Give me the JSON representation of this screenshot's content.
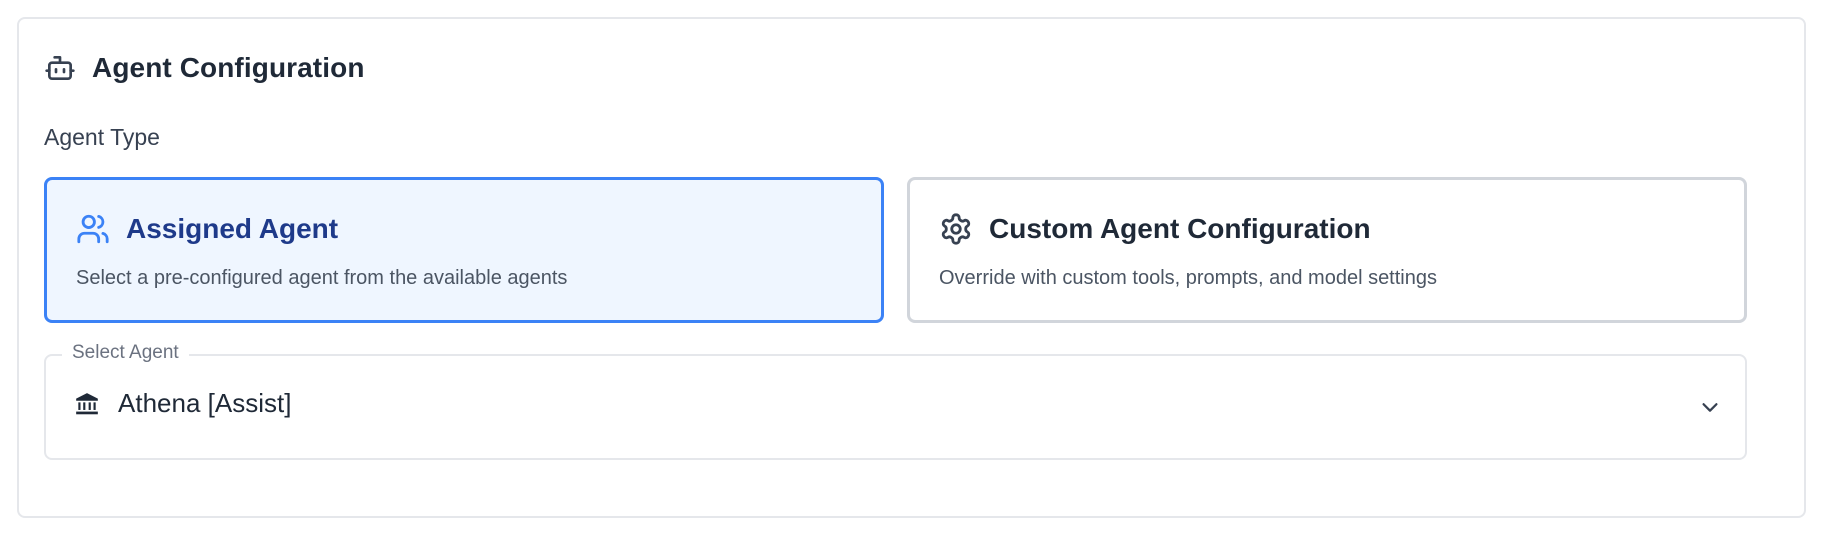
{
  "section": {
    "title": "Agent Configuration",
    "title_icon": "robot-icon"
  },
  "agent_type": {
    "label": "Agent Type",
    "options": [
      {
        "id": "assigned",
        "title": "Assigned Agent",
        "description": "Select a pre-configured agent from the available agents",
        "icon": "users-icon",
        "selected": true
      },
      {
        "id": "custom",
        "title": "Custom Agent Configuration",
        "description": "Override with custom tools, prompts, and model settings",
        "icon": "gear-icon",
        "selected": false
      }
    ]
  },
  "select_agent": {
    "label": "Select Agent",
    "value": "Athena [Assist]",
    "value_icon": "bank-icon",
    "dropdown_icon": "chevron-down-icon"
  },
  "colors": {
    "accent": "#3b82f6",
    "selected_bg": "#eff6ff",
    "selected_title": "#1e3a8a",
    "border": "#d1d5db"
  }
}
